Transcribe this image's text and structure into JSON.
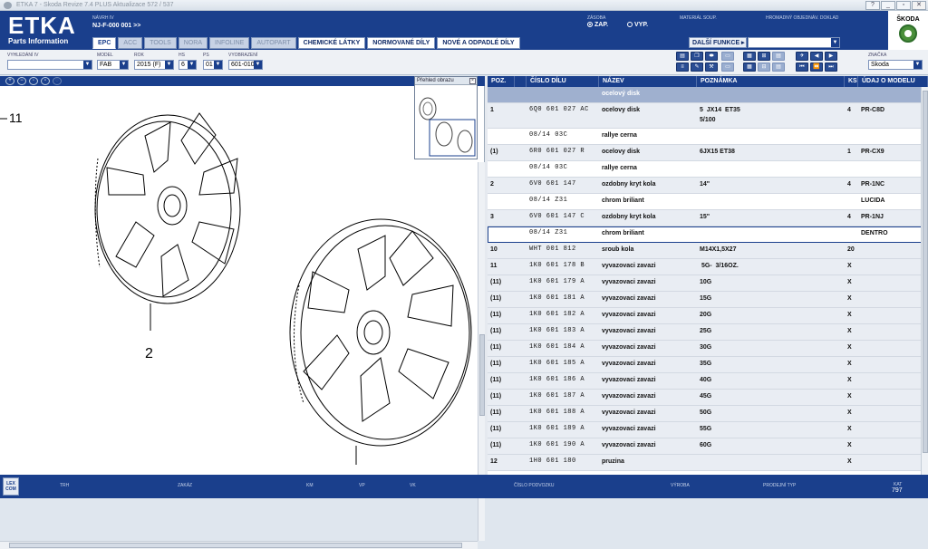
{
  "titlebar": {
    "title": "ETKA 7 - Skoda Revize 7.4 PLUS Aktualizace 572 / 537"
  },
  "header": {
    "logo": "ETKA",
    "logo_sub": "Parts Information",
    "navrh_label": "NÁVRH IV",
    "navrh_value": "NJ-F-000 001 >>",
    "zasoba_label": "ZÁSOBA",
    "zap": "ZAP.",
    "vyp": "VYP.",
    "material_label": "MATERIÁL  SOUP.",
    "hromadny_label": "HROMADNÝ OBJEDNÁV. DOKLAD",
    "brand": "ŠKODA"
  },
  "tabs": [
    {
      "label": "EPC",
      "state": "active"
    },
    {
      "label": "ACC",
      "state": "dim"
    },
    {
      "label": "TOOLS",
      "state": "dim"
    },
    {
      "label": "NORA",
      "state": "dim"
    },
    {
      "label": "INFOLINE",
      "state": "dim"
    },
    {
      "label": "AUTOPART",
      "state": "dim"
    },
    {
      "label": "CHEMICKÉ LÁTKY",
      "state": "bold"
    },
    {
      "label": "NORMOVANÉ DÍLY",
      "state": "bold"
    },
    {
      "label": "NOVÉ A ODPADLÉ DÍLY",
      "state": "bold"
    }
  ],
  "dalsi_funkce": "DALŠÍ FUNKCE ▸",
  "filters": {
    "vyhledani": {
      "label": "VYHLEDÁNÍ IV",
      "value": ""
    },
    "model": {
      "label": "MODEL",
      "value": "FAB"
    },
    "rok": {
      "label": "ROK",
      "value": "2015 (F)"
    },
    "hs": {
      "label": "HS",
      "value": "6"
    },
    "ps": {
      "label": "PS",
      "value": "01"
    },
    "vyobrazeni": {
      "label": "VYOBRAZENÍ",
      "value": "601-010"
    },
    "znacka": {
      "label": "ZNAČKA",
      "value": "Skoda"
    }
  },
  "illustration": {
    "callouts": [
      "11",
      "2"
    ],
    "thumb_title": "Přehled obrazu"
  },
  "grid": {
    "headers": [
      "POZ.",
      "",
      "ČÍSLO DÍLU",
      "NÁZEV",
      "POZNÁMKA",
      "KS",
      "ÚDAJ O MODELU"
    ],
    "rows": [
      {
        "poz": "",
        "cislo": "",
        "nazev": "ocelový disk",
        "poznamka": "",
        "ks": "",
        "udaj": "",
        "type": "cat",
        "h": 18
      },
      {
        "poz": "1",
        "cislo": "6Q0 601 027 AC",
        "nazev": "ocelovy disk",
        "poznamka": "5  JX14  ET35\n5/100",
        "ks": "4",
        "udaj": "PR-C8D",
        "type": "alt",
        "h": 28
      },
      {
        "poz": "",
        "cislo": "08/14          03C",
        "nazev": "rallye cerna",
        "poznamka": "",
        "ks": "",
        "udaj": "",
        "type": "",
        "h": 18
      },
      {
        "poz": "(1)",
        "cislo": "6R0 601 027 R",
        "nazev": "ocelovy disk",
        "poznamka": "6JX15 ET38",
        "ks": "1",
        "udaj": "PR-CX9",
        "type": "alt",
        "h": 18
      },
      {
        "poz": "",
        "cislo": "08/14          03C",
        "nazev": "rallye cerna",
        "poznamka": "",
        "ks": "",
        "udaj": "",
        "type": "",
        "h": 18
      },
      {
        "poz": "2",
        "cislo": "6V0 601 147",
        "nazev": "ozdobny kryt kola",
        "poznamka": "14\"",
        "ks": "4",
        "udaj": "PR-1NC",
        "type": "alt",
        "h": 18
      },
      {
        "poz": "",
        "cislo": "08/14          Z31",
        "nazev": "chrom briliant",
        "poznamka": "",
        "ks": "",
        "udaj": "LUCIDA",
        "type": "",
        "h": 18
      },
      {
        "poz": "3",
        "cislo": "6V0 601 147 C",
        "nazev": "ozdobny kryt kola",
        "poznamka": "15\"",
        "ks": "4",
        "udaj": "PR-1NJ",
        "type": "alt",
        "h": 18
      },
      {
        "poz": "",
        "cislo": "08/14          Z31",
        "nazev": "chrom briliant",
        "poznamka": "",
        "ks": "",
        "udaj": "DENTRO",
        "type": "sel",
        "h": 18
      },
      {
        "poz": "10",
        "cislo": "WHT 001 812",
        "nazev": "sroub kola",
        "poznamka": "M14X1,5X27",
        "ks": "20",
        "udaj": "",
        "type": "alt",
        "h": 18
      },
      {
        "poz": "11",
        "cislo": "1K0 601 178 B",
        "nazev": "vyvazovaci zavazi",
        "poznamka": " 5G-  3/16OZ.",
        "ks": "X",
        "udaj": "",
        "type": "alt",
        "h": 18
      },
      {
        "poz": "(11)",
        "cislo": "1K0 601 179 A",
        "nazev": "vyvazovaci zavazi",
        "poznamka": "10G",
        "ks": "X",
        "udaj": "",
        "type": "alt",
        "h": 18
      },
      {
        "poz": "(11)",
        "cislo": "1K0 601 181 A",
        "nazev": "vyvazovaci zavazi",
        "poznamka": "15G",
        "ks": "X",
        "udaj": "",
        "type": "alt",
        "h": 18
      },
      {
        "poz": "(11)",
        "cislo": "1K0 601 182 A",
        "nazev": "vyvazovaci zavazi",
        "poznamka": "20G",
        "ks": "X",
        "udaj": "",
        "type": "alt",
        "h": 18
      },
      {
        "poz": "(11)",
        "cislo": "1K0 601 183 A",
        "nazev": "vyvazovaci zavazi",
        "poznamka": "25G",
        "ks": "X",
        "udaj": "",
        "type": "alt",
        "h": 18
      },
      {
        "poz": "(11)",
        "cislo": "1K0 601 184 A",
        "nazev": "vyvazovaci zavazi",
        "poznamka": "30G",
        "ks": "X",
        "udaj": "",
        "type": "alt",
        "h": 18
      },
      {
        "poz": "(11)",
        "cislo": "1K0 601 185 A",
        "nazev": "vyvazovaci zavazi",
        "poznamka": "35G",
        "ks": "X",
        "udaj": "",
        "type": "alt",
        "h": 18
      },
      {
        "poz": "(11)",
        "cislo": "1K0 601 186 A",
        "nazev": "vyvazovaci zavazi",
        "poznamka": "40G",
        "ks": "X",
        "udaj": "",
        "type": "alt",
        "h": 18
      },
      {
        "poz": "(11)",
        "cislo": "1K0 601 187 A",
        "nazev": "vyvazovaci zavazi",
        "poznamka": "45G",
        "ks": "X",
        "udaj": "",
        "type": "alt",
        "h": 18
      },
      {
        "poz": "(11)",
        "cislo": "1K0 601 188 A",
        "nazev": "vyvazovaci zavazi",
        "poznamka": "50G",
        "ks": "X",
        "udaj": "",
        "type": "alt",
        "h": 18
      },
      {
        "poz": "(11)",
        "cislo": "1K0 601 189 A",
        "nazev": "vyvazovaci zavazi",
        "poznamka": "55G",
        "ks": "X",
        "udaj": "",
        "type": "alt",
        "h": 18
      },
      {
        "poz": "(11)",
        "cislo": "1K0 601 190 A",
        "nazev": "vyvazovaci zavazi",
        "poznamka": "60G",
        "ks": "X",
        "udaj": "",
        "type": "alt",
        "h": 18
      },
      {
        "poz": "12",
        "cislo": "1H0 601 180",
        "nazev": "pruzina",
        "poznamka": "",
        "ks": "X",
        "udaj": "",
        "type": "alt",
        "h": 18
      }
    ]
  },
  "statusbar": {
    "logo": "LEX COM",
    "trh": "TRH",
    "zakaz": "ZAKÁZ",
    "km": "KM",
    "vp": "VP",
    "vk": "VK",
    "cislo_podvozku": "ČÍSLO PODVOZKU",
    "vyroba": "VÝROBA",
    "prodejni_typ": "PRODEJNÍ TYP",
    "kat": "KAT",
    "kat_value": "797"
  },
  "colors": {
    "brand": "#1a3f8c",
    "category_row": "#9fb0cf",
    "alt_row": "#e9edf3"
  }
}
